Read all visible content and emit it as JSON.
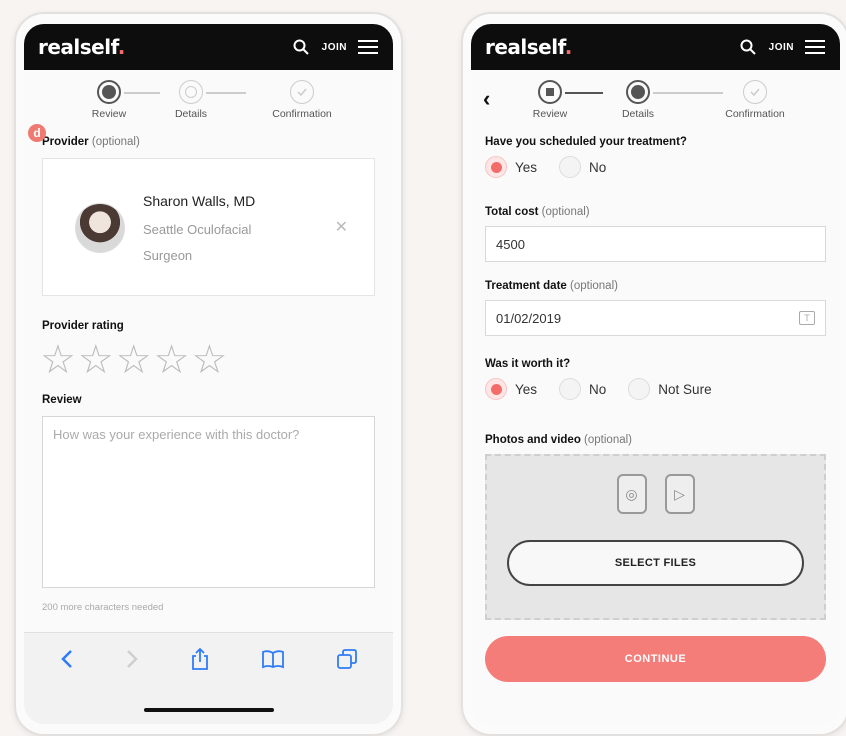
{
  "brand": {
    "logo_text": "realself",
    "logo_dot": ".",
    "accent": "#f26d6a"
  },
  "topbar": {
    "search_icon": "search-icon",
    "join_label": "JOIN",
    "menu_icon": "hamburger-menu-icon"
  },
  "steps": {
    "review": "Review",
    "details": "Details",
    "confirmation": "Confirmation"
  },
  "left": {
    "badge": "d",
    "provider_label": "Provider",
    "provider_optional": "(optional)",
    "provider": {
      "name": "Sharon Walls, MD",
      "specialty": "Seattle Oculofacial Surgeon"
    },
    "rating_label": "Provider rating",
    "rating_value": 0,
    "rating_max": 5,
    "review_label": "Review",
    "review_placeholder": "How was your experience with this doctor?",
    "chars_needed": "200 more characters needed",
    "safari_icons": [
      "back-icon",
      "forward-icon",
      "share-icon",
      "bookmarks-icon",
      "tabs-icon"
    ]
  },
  "right": {
    "back_icon": "back-chevron-icon",
    "scheduled_question": "Have you scheduled your treatment?",
    "scheduled_options": [
      "Yes",
      "No"
    ],
    "scheduled_selected": "Yes",
    "total_cost_label": "Total cost",
    "total_cost_optional": "(optional)",
    "total_cost_value": "4500",
    "treatment_date_label": "Treatment date",
    "treatment_date_optional": "(optional)",
    "treatment_date_value": "01/02/2019",
    "worth_question": "Was it worth it?",
    "worth_options": [
      "Yes",
      "No",
      "Not Sure"
    ],
    "worth_selected": "Yes",
    "photos_label": "Photos and video",
    "photos_optional": "(optional)",
    "select_files_label": "SELECT FILES",
    "continue_label": "CONTINUE"
  }
}
